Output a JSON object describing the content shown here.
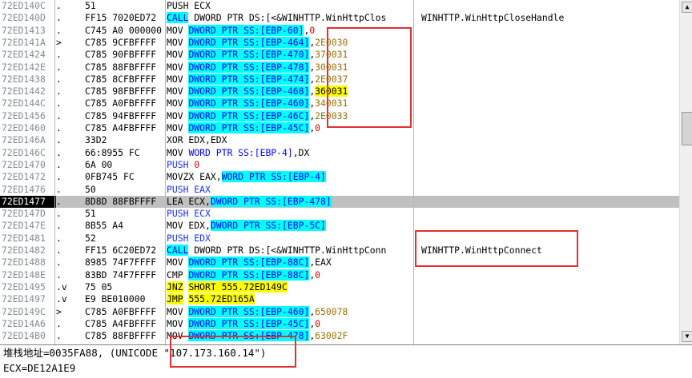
{
  "colors": {
    "accent_red": "#e03030",
    "cyan": "#00ffff",
    "yellow": "#ffff00"
  },
  "rows": [
    {
      "addr": "72ED140C",
      "mark": ".",
      "hex": "51",
      "seg": [
        {
          "t": "PUSH ECX"
        }
      ],
      "cmt": ""
    },
    {
      "addr": "72ED140D",
      "mark": ".",
      "hex": "FF15 7020ED72",
      "seg": [
        {
          "t": "CALL",
          "c": "cyan"
        },
        {
          "t": " DWORD PTR DS:[<&WINHTTP.WinHttpClos"
        }
      ],
      "cmt": "WINHTTP.WinHttpCloseHandle"
    },
    {
      "addr": "72ED1413",
      "mark": ".",
      "hex": "C745 A0 000000",
      "seg": [
        {
          "t": "MOV "
        },
        {
          "t": "DWORD PTR SS:[EBP-60]",
          "c": "cyan"
        },
        {
          "t": ","
        },
        {
          "t": "0",
          "c": "red"
        }
      ],
      "cmt": ""
    },
    {
      "addr": "72ED141A",
      "mark": ">",
      "hex": "C785 9CFBFFFF",
      "seg": [
        {
          "t": "MOV "
        },
        {
          "t": "DWORD PTR SS:[EBP-464]",
          "c": "cyan"
        },
        {
          "t": ","
        },
        {
          "t": "2E0030",
          "c": "olive"
        }
      ],
      "cmt": ""
    },
    {
      "addr": "72ED1424",
      "mark": ".",
      "hex": "C785 90FBFFFF",
      "seg": [
        {
          "t": "MOV "
        },
        {
          "t": "DWORD PTR SS:[EBP-470]",
          "c": "cyan"
        },
        {
          "t": ","
        },
        {
          "t": "370031",
          "c": "olive"
        }
      ],
      "cmt": ""
    },
    {
      "addr": "72ED142E",
      "mark": ".",
      "hex": "C785 88FBFFFF",
      "seg": [
        {
          "t": "MOV "
        },
        {
          "t": "DWORD PTR SS:[EBP-478]",
          "c": "cyan"
        },
        {
          "t": ","
        },
        {
          "t": "300031",
          "c": "olive"
        }
      ],
      "cmt": ""
    },
    {
      "addr": "72ED1438",
      "mark": ".",
      "hex": "C785 8CFBFFFF",
      "seg": [
        {
          "t": "MOV "
        },
        {
          "t": "DWORD PTR SS:[EBP-474]",
          "c": "cyan"
        },
        {
          "t": ","
        },
        {
          "t": "2E0037",
          "c": "olive"
        }
      ],
      "cmt": ""
    },
    {
      "addr": "72ED1442",
      "mark": ".",
      "hex": "C785 98FBFFFF",
      "seg": [
        {
          "t": "MOV "
        },
        {
          "t": "DWORD PTR SS:[EBP-468]",
          "c": "cyan"
        },
        {
          "t": ","
        },
        {
          "t": "360031",
          "c": "yel"
        }
      ],
      "cmt": ""
    },
    {
      "addr": "72ED144C",
      "mark": ".",
      "hex": "C785 A0FBFFFF",
      "seg": [
        {
          "t": "MOV "
        },
        {
          "t": "DWORD PTR SS:[EBP-460]",
          "c": "cyan"
        },
        {
          "t": ","
        },
        {
          "t": "340031",
          "c": "olive"
        }
      ],
      "cmt": ""
    },
    {
      "addr": "72ED1456",
      "mark": ".",
      "hex": "C785 94FBFFFF",
      "seg": [
        {
          "t": "MOV "
        },
        {
          "t": "DWORD PTR SS:[EBP-46C]",
          "c": "cyan"
        },
        {
          "t": ","
        },
        {
          "t": "2E0033",
          "c": "olive"
        }
      ],
      "cmt": ""
    },
    {
      "addr": "72ED1460",
      "mark": ".",
      "hex": "C785 A4FBFFFF",
      "seg": [
        {
          "t": "MOV "
        },
        {
          "t": "DWORD PTR SS:[EBP-45C]",
          "c": "cyan"
        },
        {
          "t": ","
        },
        {
          "t": "0",
          "c": "red"
        }
      ],
      "cmt": ""
    },
    {
      "addr": "72ED146A",
      "mark": ".",
      "hex": "33D2",
      "seg": [
        {
          "t": "XOR EDX,EDX"
        }
      ],
      "cmt": ""
    },
    {
      "addr": "72ED146C",
      "mark": ".",
      "hex": "66:8955 FC",
      "seg": [
        {
          "t": "MOV "
        },
        {
          "t": "WORD PTR SS:[EBP-4]",
          "c": "fc"
        },
        {
          "t": ",DX"
        }
      ],
      "cmt": ""
    },
    {
      "addr": "72ED1470",
      "mark": ".",
      "hex": "6A 00",
      "seg": [
        {
          "t": "PUSH ",
          "c": "blue"
        },
        {
          "t": "0",
          "c": "red"
        }
      ],
      "cmt": ""
    },
    {
      "addr": "72ED1472",
      "mark": ".",
      "hex": "0FB745 FC",
      "seg": [
        {
          "t": "MOVZX EAX,"
        },
        {
          "t": "WORD PTR SS:[EBP-4]",
          "c": "cyan"
        }
      ],
      "cmt": ""
    },
    {
      "addr": "72ED1476",
      "mark": ".",
      "hex": "50",
      "seg": [
        {
          "t": "PUSH EAX",
          "c": "blue"
        }
      ],
      "cmt": ""
    },
    {
      "addr": "72ED1477",
      "mark": ".",
      "hex": "8D8D 88FBFFFF",
      "seg": [
        {
          "t": "LEA ECX,"
        },
        {
          "t": "DWORD PTR SS:[EBP-478]",
          "c": "cyan"
        }
      ],
      "cmt": "",
      "sel": true
    },
    {
      "addr": "72ED147D",
      "mark": ".",
      "hex": "51",
      "seg": [
        {
          "t": "PUSH ECX",
          "c": "blue"
        }
      ],
      "cmt": ""
    },
    {
      "addr": "72ED147E",
      "mark": ".",
      "hex": "8B55 A4",
      "seg": [
        {
          "t": "MOV EDX,"
        },
        {
          "t": "DWORD PTR SS:[EBP-5C]",
          "c": "cyan"
        }
      ],
      "cmt": ""
    },
    {
      "addr": "72ED1481",
      "mark": ".",
      "hex": "52",
      "seg": [
        {
          "t": "PUSH EDX",
          "c": "blue"
        }
      ],
      "cmt": ""
    },
    {
      "addr": "72ED1482",
      "mark": ".",
      "hex": "FF15 6C20ED72",
      "seg": [
        {
          "t": "CALL",
          "c": "cyan"
        },
        {
          "t": " DWORD PTR DS:[<&WINHTTP.WinHttpConn"
        }
      ],
      "cmt": "WINHTTP.WinHttpConnect"
    },
    {
      "addr": "72ED1488",
      "mark": ".",
      "hex": "8985 74F7FFFF",
      "seg": [
        {
          "t": "MOV "
        },
        {
          "t": "DWORD PTR SS:[EBP-88C]",
          "c": "cyan"
        },
        {
          "t": ",EAX"
        }
      ],
      "cmt": ""
    },
    {
      "addr": "72ED148E",
      "mark": ".",
      "hex": "83BD 74F7FFFF",
      "seg": [
        {
          "t": "CMP "
        },
        {
          "t": "DWORD PTR SS:[EBP-88C]",
          "c": "cyan"
        },
        {
          "t": ","
        },
        {
          "t": "0",
          "c": "red"
        }
      ],
      "cmt": ""
    },
    {
      "addr": "72ED1495",
      "mark": ".v",
      "hex": "75 05",
      "seg": [
        {
          "t": "JNZ",
          "c": "yel"
        },
        {
          "t": " "
        },
        {
          "t": "SHORT 555.72ED149C",
          "c": "yel"
        }
      ],
      "cmt": ""
    },
    {
      "addr": "72ED1497",
      "mark": ".v",
      "hex": "E9 BE010000",
      "seg": [
        {
          "t": "JMP",
          "c": "yel"
        },
        {
          "t": " "
        },
        {
          "t": "555.72ED165A",
          "c": "yel"
        }
      ],
      "cmt": ""
    },
    {
      "addr": "72ED149C",
      "mark": ">",
      "hex": "C785 A0FBFFFF",
      "seg": [
        {
          "t": "MOV "
        },
        {
          "t": "DWORD PTR SS:[EBP-460]",
          "c": "cyan"
        },
        {
          "t": ","
        },
        {
          "t": "650078",
          "c": "olive"
        }
      ],
      "cmt": ""
    },
    {
      "addr": "72ED14A6",
      "mark": ".",
      "hex": "C785 A4FBFFFF",
      "seg": [
        {
          "t": "MOV "
        },
        {
          "t": "DWORD PTR SS:[EBP-45C]",
          "c": "cyan"
        },
        {
          "t": ","
        },
        {
          "t": "0",
          "c": "red"
        }
      ],
      "cmt": ""
    },
    {
      "addr": "72ED14B0",
      "mark": ".",
      "hex": "C785 88FBFFFF",
      "seg": [
        {
          "t": "MOV "
        },
        {
          "t": "DWORD PTR SS:[EBP-478]",
          "c": "cyan"
        },
        {
          "t": ","
        },
        {
          "t": "63002F",
          "c": "olive"
        }
      ],
      "cmt": ""
    }
  ],
  "status": {
    "line1": "堆栈地址=0035FA88, (UNICODE \"107.173.160.14\")",
    "line2": "ECX=DE12A1E9"
  }
}
